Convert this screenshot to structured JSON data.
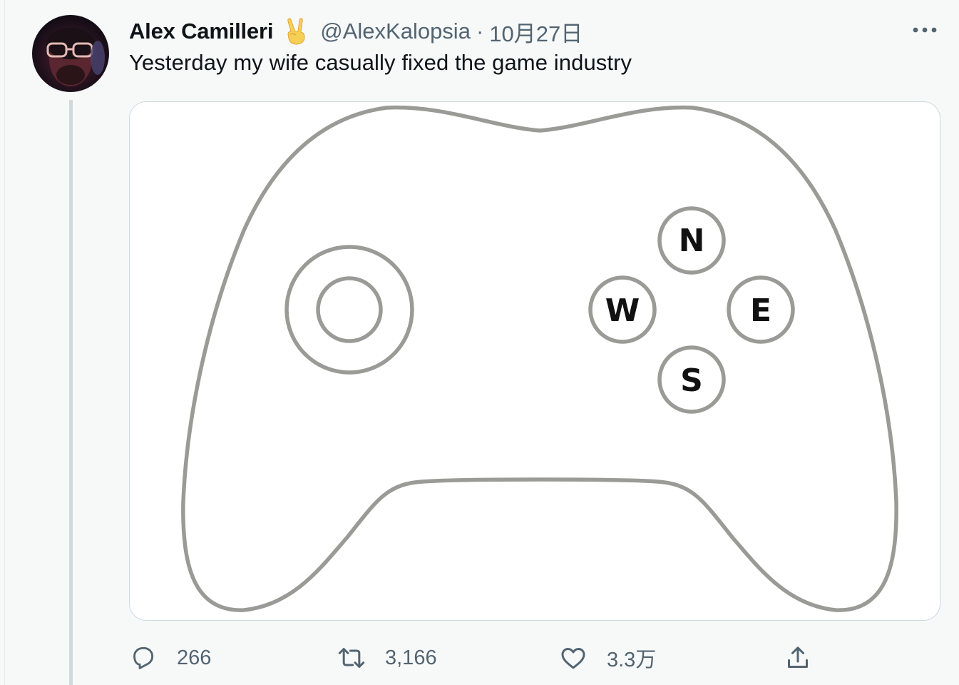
{
  "author": {
    "display_name": "Alex Camilleri",
    "emoji": "✌️",
    "handle": "@AlexKalopsia",
    "separator": "·",
    "date": "10月27日"
  },
  "tweet": {
    "text": "Yesterday my wife casually fixed the game industry"
  },
  "image": {
    "buttons": {
      "north": "N",
      "west": "W",
      "east": "E",
      "south": "S"
    },
    "colors": {
      "outline": "#9a9a96",
      "letters": "#111111"
    }
  },
  "actions": {
    "reply_count": "266",
    "retweet_count": "3,166",
    "like_count": "3.3万"
  },
  "colors": {
    "text_primary": "#0f1419",
    "text_secondary": "#536471",
    "background": "#f7f9f9",
    "border": "#cfd9de"
  },
  "icons": [
    "peace-hand-emoji-icon",
    "more-options-icon",
    "reply-icon",
    "retweet-icon",
    "like-icon",
    "share-icon"
  ]
}
